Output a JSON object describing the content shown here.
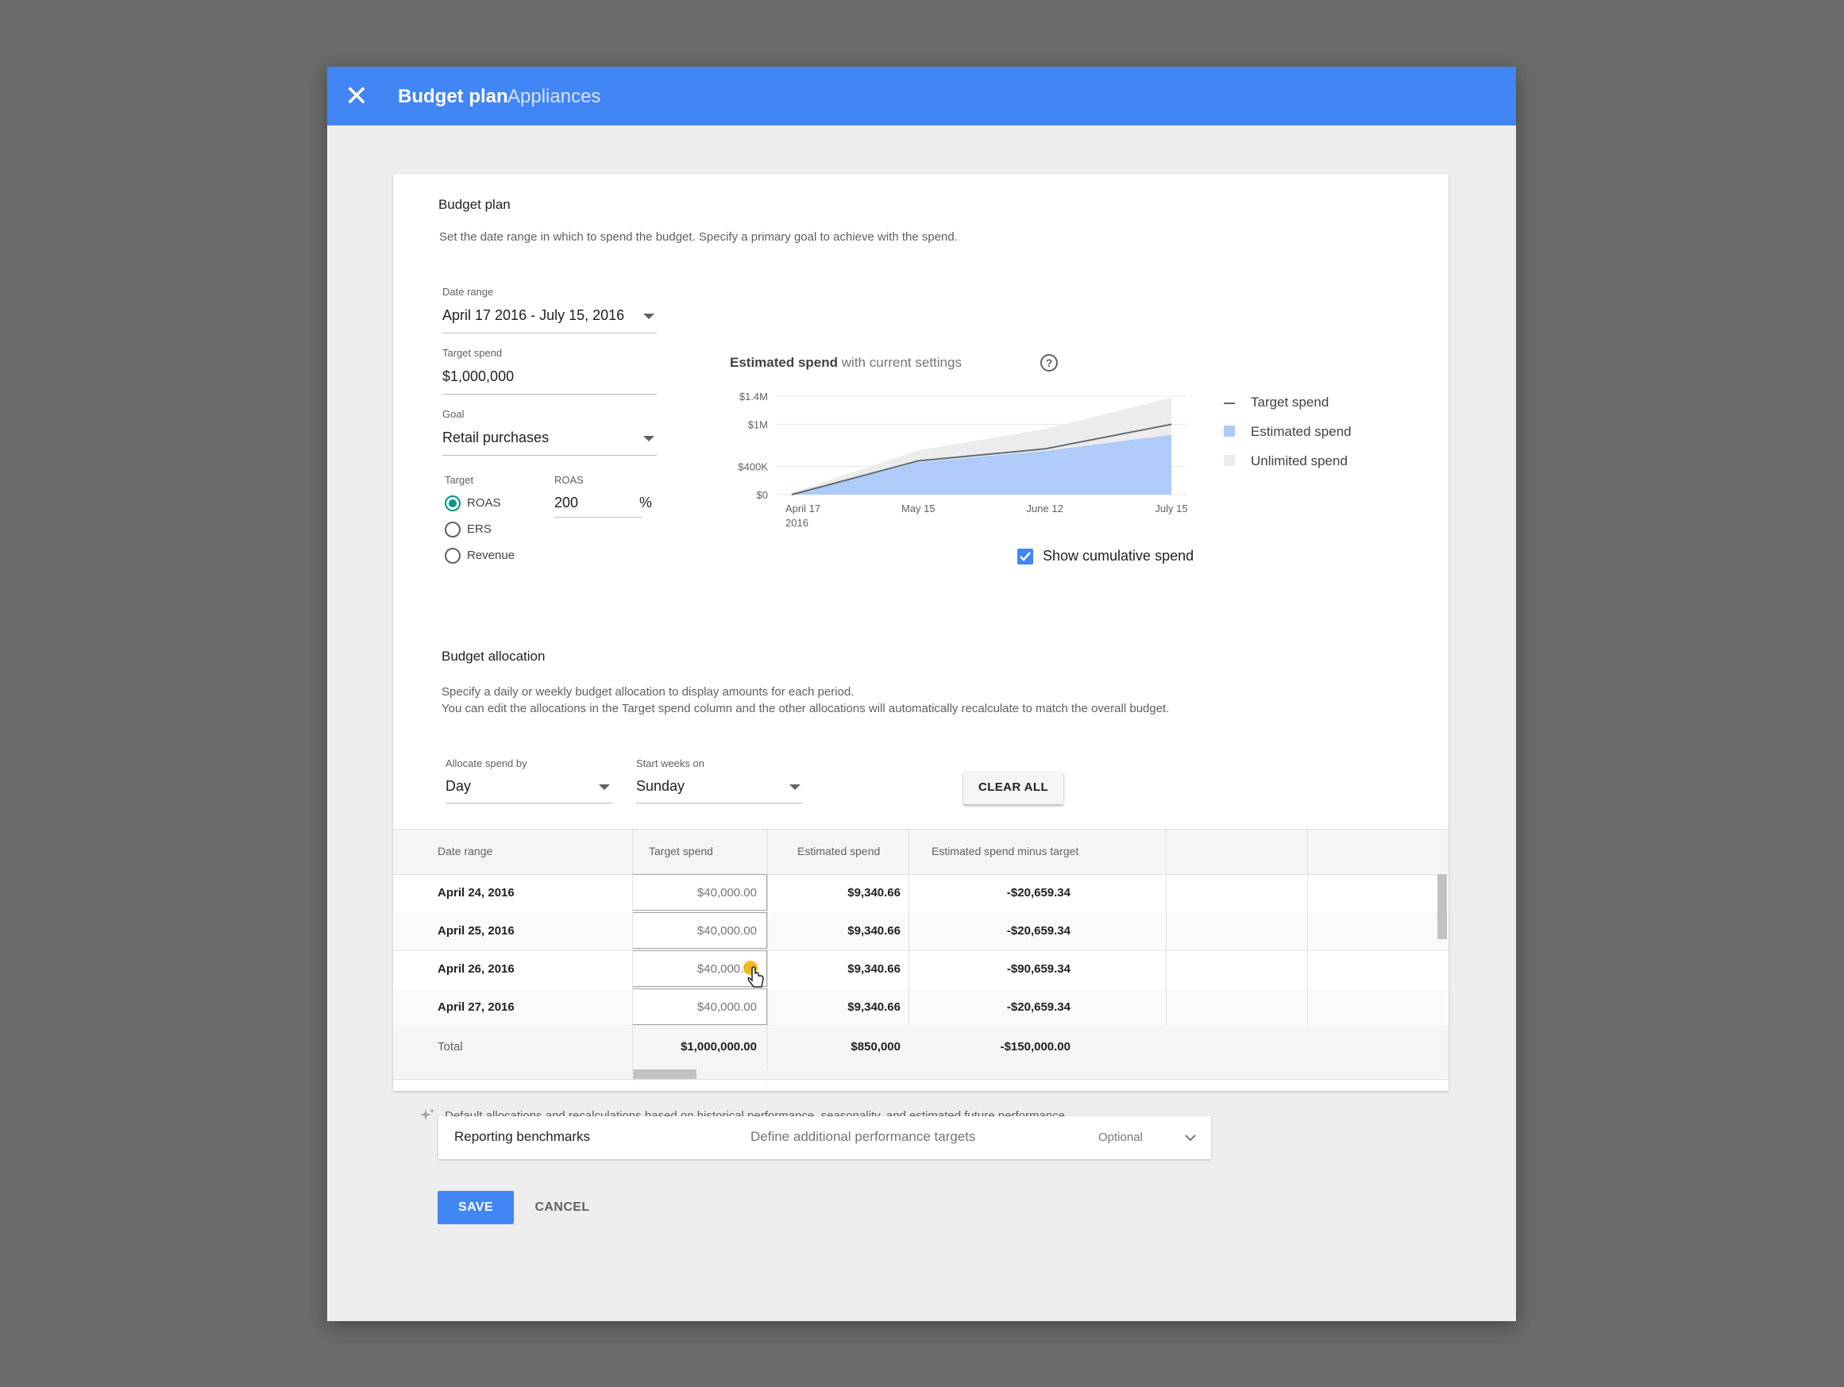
{
  "header": {
    "title": "Budget plan",
    "subtitle": "Appliances"
  },
  "budget_plan": {
    "heading": "Budget plan",
    "description": "Set the date range in which to spend the budget. Specify a primary goal to achieve with the spend.",
    "date_range_label": "Date range",
    "date_range_value": "April 17 2016 - July 15, 2016",
    "target_spend_label": "Target spend",
    "target_spend_value": "$1,000,000",
    "goal_label": "Goal",
    "goal_value": "Retail purchases",
    "target_label": "Target",
    "target_options": [
      "ROAS",
      "ERS",
      "Revenue"
    ],
    "target_selected": "ROAS",
    "roas_label": "ROAS",
    "roas_value": "200",
    "roas_unit": "%"
  },
  "chart_panel": {
    "title_bold": "Estimated spend",
    "title_rest": "with current settings",
    "help_icon": "help-circle-icon",
    "legend": [
      "Target spend",
      "Estimated spend",
      "Unlimited spend"
    ],
    "show_cumulative_label": "Show cumulative spend",
    "show_cumulative_checked": true,
    "colors": {
      "target": "#5f6b73",
      "estimated": "#aecbfa",
      "unlimited": "#ececec",
      "checkbox": "#4285f4"
    }
  },
  "chart_data": {
    "type": "area",
    "x": [
      "April 17 2016",
      "May 15",
      "June 12",
      "July 15"
    ],
    "x_tick_labels": [
      "April 17",
      "May 15",
      "June 12",
      "July 15"
    ],
    "x_tick_sublabel": "2016",
    "y_tick_labels": [
      "$0",
      "$400K",
      "$1M",
      "$1.4M"
    ],
    "y_ticks": [
      0,
      400000,
      1000000,
      1400000
    ],
    "ylim": [
      0,
      1400000
    ],
    "series": [
      {
        "name": "Unlimited spend",
        "values": [
          30000,
          630000,
          930000,
          1380000
        ]
      },
      {
        "name": "Estimated spend",
        "values": [
          0,
          460000,
          620000,
          850000
        ]
      },
      {
        "name": "Target spend",
        "values": [
          0,
          480000,
          650000,
          1000000
        ]
      }
    ]
  },
  "allocation": {
    "heading": "Budget allocation",
    "description_1": "Specify a daily or weekly budget allocation to display amounts for each period.",
    "description_2": "You can edit the allocations in the Target spend column and the other allocations will automatically recalculate to match the overall budget.",
    "allocate_label": "Allocate spend by",
    "allocate_value": "Day",
    "start_weeks_label": "Start weeks on",
    "start_weeks_value": "Sunday",
    "clear_all": "CLEAR ALL"
  },
  "table": {
    "headers": [
      "Date range",
      "Target spend",
      "Estimated spend",
      "Estimated spend minus target"
    ],
    "rows": [
      {
        "date": "April 24, 2016",
        "target": "$40,000.00",
        "estimated": "$9,340.66",
        "diff": "-$20,659.34"
      },
      {
        "date": "April 25, 2016",
        "target": "$40,000.00",
        "estimated": "$9,340.66",
        "diff": "-$20,659.34"
      },
      {
        "date": "April 26, 2016",
        "target": "$40,000.00",
        "estimated": "$9,340.66",
        "diff": "-$90,659.34"
      },
      {
        "date": "April 27, 2016",
        "target": "$40,000.00",
        "estimated": "$9,340.66",
        "diff": "-$20,659.34"
      }
    ],
    "total": {
      "label": "Total",
      "target": "$1,000,000.00",
      "estimated": "$850,000",
      "diff": "-$150,000.00"
    }
  },
  "footnote": "Default allocations and recalculations based on historical performance, seasonality, and estimated future performance.",
  "benchmarks": {
    "title": "Reporting benchmarks",
    "description": "Define additional performance targets",
    "optional": "Optional"
  },
  "actions": {
    "save": "SAVE",
    "cancel": "CANCEL"
  }
}
